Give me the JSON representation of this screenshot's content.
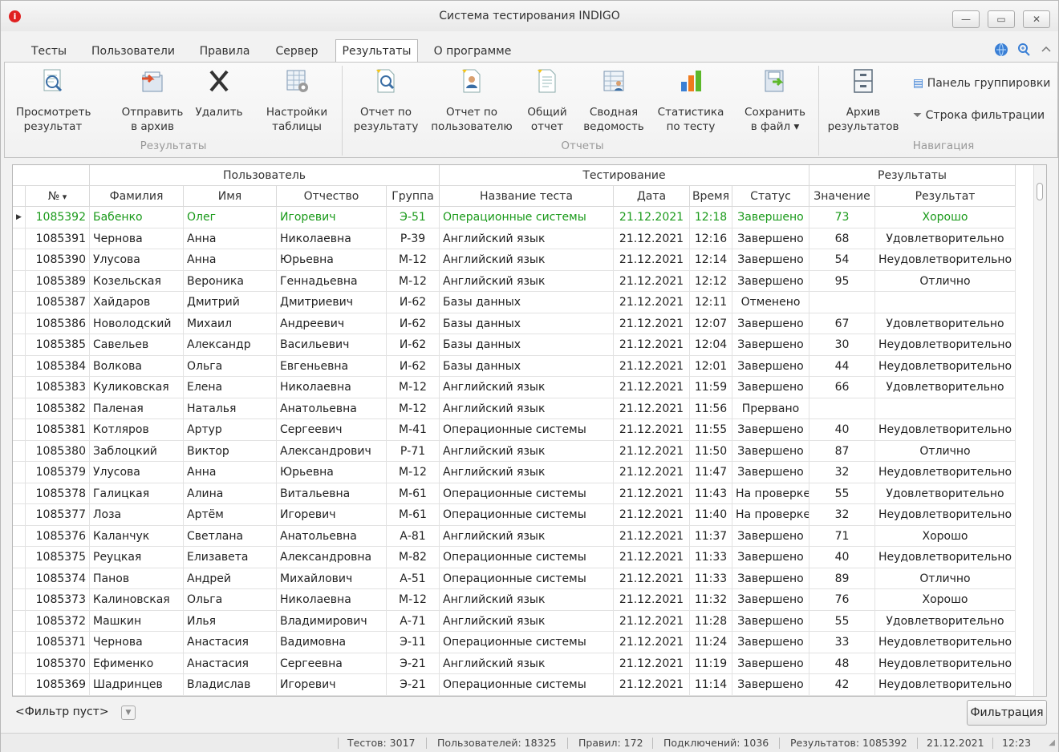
{
  "window": {
    "title": "Система тестирования INDIGO",
    "logo_glyph": "i"
  },
  "menu_tabs": [
    "Тесты",
    "Пользователи",
    "Правила",
    "Сервер",
    "Результаты",
    "О программе"
  ],
  "ribbon": {
    "results_group": {
      "label": "Результаты",
      "buttons": [
        "Просмотреть\nрезультат",
        "Отправить\nв архив",
        "Удалить",
        "Настройки\nтаблицы"
      ]
    },
    "reports_group": {
      "label": "Отчеты",
      "buttons": [
        "Отчет по\nрезультату",
        "Отчет по\nпользователю",
        "Общий\nотчет",
        "Сводная\nведомость",
        "Статистика\nпо тесту",
        "Сохранить\nв файл ▾"
      ]
    },
    "nav_group": {
      "label": "Навигация",
      "archive": "Архив\nрезультатов",
      "grouping_panel": "Панель группировки",
      "filter_row": "Строка фильтрации"
    }
  },
  "grid": {
    "bands": [
      "Пользователь",
      "Тестирование",
      "Результаты"
    ],
    "columns": [
      "№",
      "Фамилия",
      "Имя",
      "Отчество",
      "Группа",
      "Название теста",
      "Дата",
      "Время",
      "Статус",
      "Значение",
      "Результат"
    ],
    "rows": [
      [
        "1085392",
        "Бабенко",
        "Олег",
        "Игоревич",
        "Э-51",
        "Операционные системы",
        "21.12.2021",
        "12:18",
        "Завершено",
        "73",
        "Хорошо"
      ],
      [
        "1085391",
        "Чернова",
        "Анна",
        "Николаевна",
        "Р-39",
        "Английский язык",
        "21.12.2021",
        "12:16",
        "Завершено",
        "68",
        "Удовлетворительно"
      ],
      [
        "1085390",
        "Улусова",
        "Анна",
        "Юрьевна",
        "М-12",
        "Английский язык",
        "21.12.2021",
        "12:14",
        "Завершено",
        "54",
        "Неудовлетворительно"
      ],
      [
        "1085389",
        "Козельская",
        "Вероника",
        "Геннадьевна",
        "М-12",
        "Английский язык",
        "21.12.2021",
        "12:12",
        "Завершено",
        "95",
        "Отлично"
      ],
      [
        "1085387",
        "Хайдаров",
        "Дмитрий",
        "Дмитриевич",
        "И-62",
        "Базы данных",
        "21.12.2021",
        "12:11",
        "Отменено",
        "",
        ""
      ],
      [
        "1085386",
        "Новолодский",
        "Михаил",
        "Андреевич",
        "И-62",
        "Базы данных",
        "21.12.2021",
        "12:07",
        "Завершено",
        "67",
        "Удовлетворительно"
      ],
      [
        "1085385",
        "Савельев",
        "Александр",
        "Васильевич",
        "И-62",
        "Базы данных",
        "21.12.2021",
        "12:04",
        "Завершено",
        "30",
        "Неудовлетворительно"
      ],
      [
        "1085384",
        "Волкова",
        "Ольга",
        "Евгеньевна",
        "И-62",
        "Базы данных",
        "21.12.2021",
        "12:01",
        "Завершено",
        "44",
        "Неудовлетворительно"
      ],
      [
        "1085383",
        "Куликовская",
        "Елена",
        "Николаевна",
        "М-12",
        "Английский язык",
        "21.12.2021",
        "11:59",
        "Завершено",
        "66",
        "Удовлетворительно"
      ],
      [
        "1085382",
        "Паленая",
        "Наталья",
        "Анатольевна",
        "М-12",
        "Английский язык",
        "21.12.2021",
        "11:56",
        "Прервано",
        "",
        ""
      ],
      [
        "1085381",
        "Котляров",
        "Артур",
        "Сергеевич",
        "М-41",
        "Операционные системы",
        "21.12.2021",
        "11:55",
        "Завершено",
        "40",
        "Неудовлетворительно"
      ],
      [
        "1085380",
        "Заблоцкий",
        "Виктор",
        "Александрович",
        "Р-71",
        "Английский язык",
        "21.12.2021",
        "11:50",
        "Завершено",
        "87",
        "Отлично"
      ],
      [
        "1085379",
        "Улусова",
        "Анна",
        "Юрьевна",
        "М-12",
        "Английский язык",
        "21.12.2021",
        "11:47",
        "Завершено",
        "32",
        "Неудовлетворительно"
      ],
      [
        "1085378",
        "Галицкая",
        "Алина",
        "Витальевна",
        "М-61",
        "Операционные системы",
        "21.12.2021",
        "11:43",
        "На проверке",
        "55",
        "Удовлетворительно"
      ],
      [
        "1085377",
        "Лоза",
        "Артём",
        "Игоревич",
        "М-61",
        "Операционные системы",
        "21.12.2021",
        "11:40",
        "На проверке",
        "32",
        "Неудовлетворительно"
      ],
      [
        "1085376",
        "Каланчук",
        "Светлана",
        "Анатольевна",
        "А-81",
        "Английский язык",
        "21.12.2021",
        "11:37",
        "Завершено",
        "71",
        "Хорошо"
      ],
      [
        "1085375",
        "Реуцкая",
        "Елизавета",
        "Александровна",
        "М-82",
        "Операционные системы",
        "21.12.2021",
        "11:33",
        "Завершено",
        "40",
        "Неудовлетворительно"
      ],
      [
        "1085374",
        "Панов",
        "Андрей",
        "Михайлович",
        "А-51",
        "Операционные системы",
        "21.12.2021",
        "11:33",
        "Завершено",
        "89",
        "Отлично"
      ],
      [
        "1085373",
        "Калиновская",
        "Ольга",
        "Николаевна",
        "М-12",
        "Английский язык",
        "21.12.2021",
        "11:32",
        "Завершено",
        "76",
        "Хорошо"
      ],
      [
        "1085372",
        "Машкин",
        "Илья",
        "Владимирович",
        "А-71",
        "Английский язык",
        "21.12.2021",
        "11:28",
        "Завершено",
        "55",
        "Удовлетворительно"
      ],
      [
        "1085371",
        "Чернова",
        "Анастасия",
        "Вадимовна",
        "Э-11",
        "Операционные системы",
        "21.12.2021",
        "11:24",
        "Завершено",
        "33",
        "Неудовлетворительно"
      ],
      [
        "1085370",
        "Ефименко",
        "Анастасия",
        "Сергеевна",
        "Э-21",
        "Английский язык",
        "21.12.2021",
        "11:19",
        "Завершено",
        "48",
        "Неудовлетворительно"
      ],
      [
        "1085369",
        "Шадринцев",
        "Владислав",
        "Игоревич",
        "Э-21",
        "Операционные системы",
        "21.12.2021",
        "11:14",
        "Завершено",
        "42",
        "Неудовлетворительно"
      ]
    ]
  },
  "filter": {
    "text": "<Фильтр пуст>",
    "button": "Фильтрация"
  },
  "status": {
    "tests": "Тестов: 3017",
    "users": "Пользователей: 18325",
    "rules": "Правил: 172",
    "connections": "Подключений: 1036",
    "results": "Результатов: 1085392",
    "date": "21.12.2021",
    "time": "12:23"
  },
  "colors": {
    "selected_row_text": "#1a9a1a",
    "accent_green": "#5cb82a",
    "accent_blue": "#3a7fd5"
  }
}
